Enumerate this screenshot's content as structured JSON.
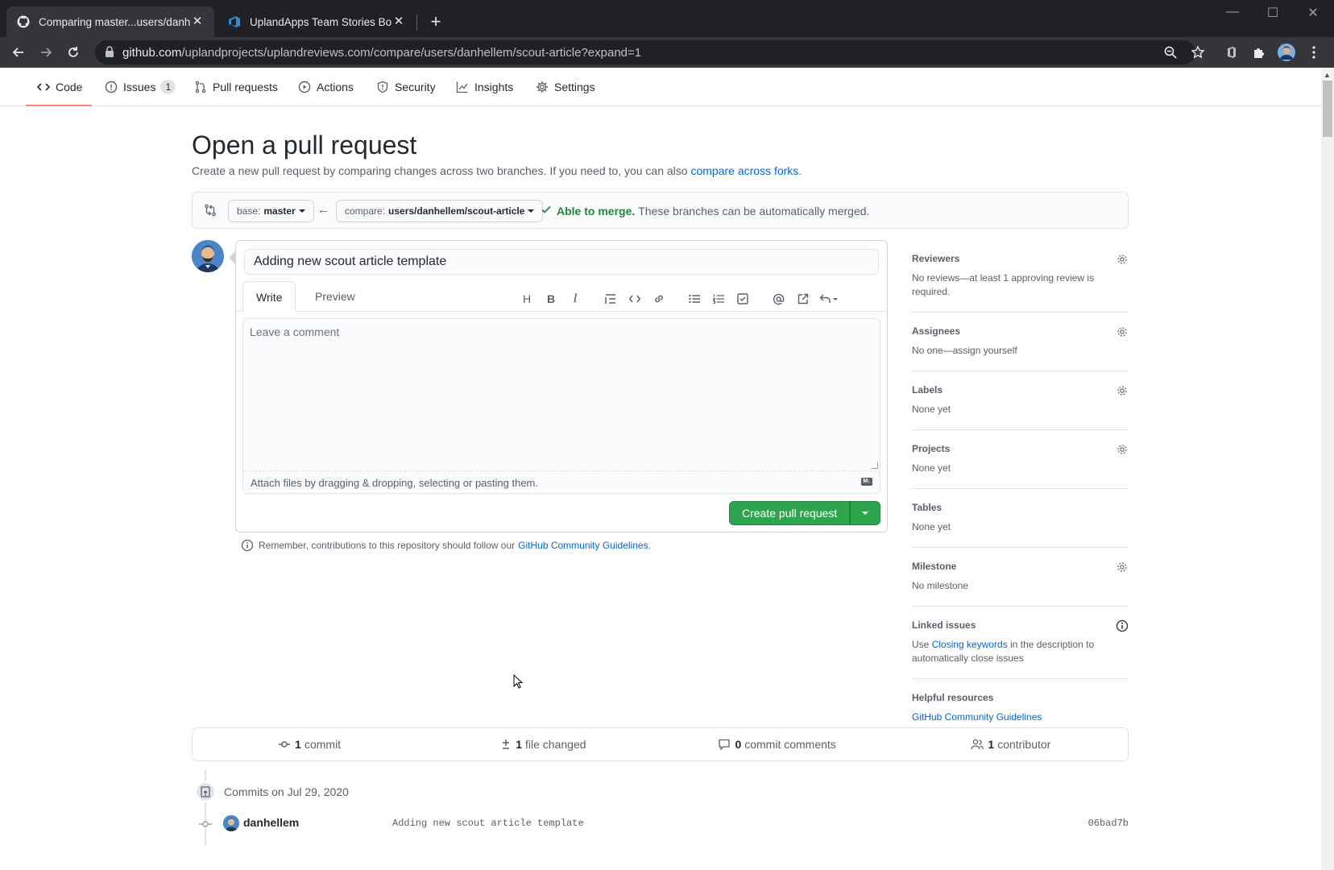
{
  "browser": {
    "tabs": [
      {
        "title": "Comparing master...users/danhel",
        "active": true
      },
      {
        "title": "UplandApps Team Stories Board",
        "active": false
      }
    ],
    "url_host": "github.com",
    "url_path": "/uplandprojects/uplandreviews.com/compare/users/danhellem/scout-article?expand=1"
  },
  "repo_nav": {
    "items": [
      {
        "label": "Code",
        "icon": "code-icon",
        "selected": true
      },
      {
        "label": "Issues",
        "icon": "issue-icon",
        "count": "1"
      },
      {
        "label": "Pull requests",
        "icon": "pull-request-icon"
      },
      {
        "label": "Actions",
        "icon": "play-icon"
      },
      {
        "label": "Security",
        "icon": "shield-icon"
      },
      {
        "label": "Insights",
        "icon": "graph-icon"
      },
      {
        "label": "Settings",
        "icon": "gear-icon"
      }
    ]
  },
  "page": {
    "title": "Open a pull request",
    "subtitle": "Create a new pull request by comparing changes across two branches. If you need to, you can also",
    "subtitle_link": "compare across forks",
    "subtitle_end": "."
  },
  "range": {
    "base_prefix": "base:",
    "base_branch": "master",
    "compare_prefix": "compare:",
    "compare_branch": "users/danhellem/scout-article",
    "merge_ok": "Able to merge.",
    "merge_text": "These branches can be automatically merged."
  },
  "editor": {
    "title_value": "Adding new scout article template",
    "tab_write": "Write",
    "tab_preview": "Preview",
    "comment_placeholder": "Leave a comment",
    "attach_text": "Attach files by dragging & dropping, selecting or pasting them.",
    "create_label": "Create pull request"
  },
  "guidelines": {
    "text": "Remember, contributions to this repository should follow our",
    "link": "GitHub Community Guidelines",
    "end": "."
  },
  "sidebar": {
    "reviewers": {
      "head": "Reviewers",
      "value": "No reviews—at least 1 approving review is required."
    },
    "assignees": {
      "head": "Assignees",
      "value": "No one—assign yourself"
    },
    "labels": {
      "head": "Labels",
      "value": "None yet"
    },
    "projects": {
      "head": "Projects",
      "value": "None yet"
    },
    "tables": {
      "head": "Tables",
      "value": "None yet"
    },
    "milestone": {
      "head": "Milestone",
      "value": "No milestone"
    },
    "linked": {
      "head": "Linked issues",
      "pre": "Use",
      "link": "Closing keywords",
      "post": "in the description to automatically close issues"
    },
    "helpful": {
      "head": "Helpful resources",
      "link": "GitHub Community Guidelines"
    }
  },
  "summary": {
    "commits_n": "1",
    "commits_label": "commit",
    "files_n": "1",
    "files_label": "file changed",
    "comments_n": "0",
    "comments_label": "commit comments",
    "contrib_n": "1",
    "contrib_label": "contributor"
  },
  "commits": {
    "heading": "Commits on Jul 29, 2020",
    "author": "danhellem",
    "message": "Adding new scout article template",
    "sha": "06bad7b"
  },
  "colors": {
    "accent_green": "#2ea44f",
    "link_blue": "#0366d6",
    "nav_underline": "#f9826c"
  }
}
